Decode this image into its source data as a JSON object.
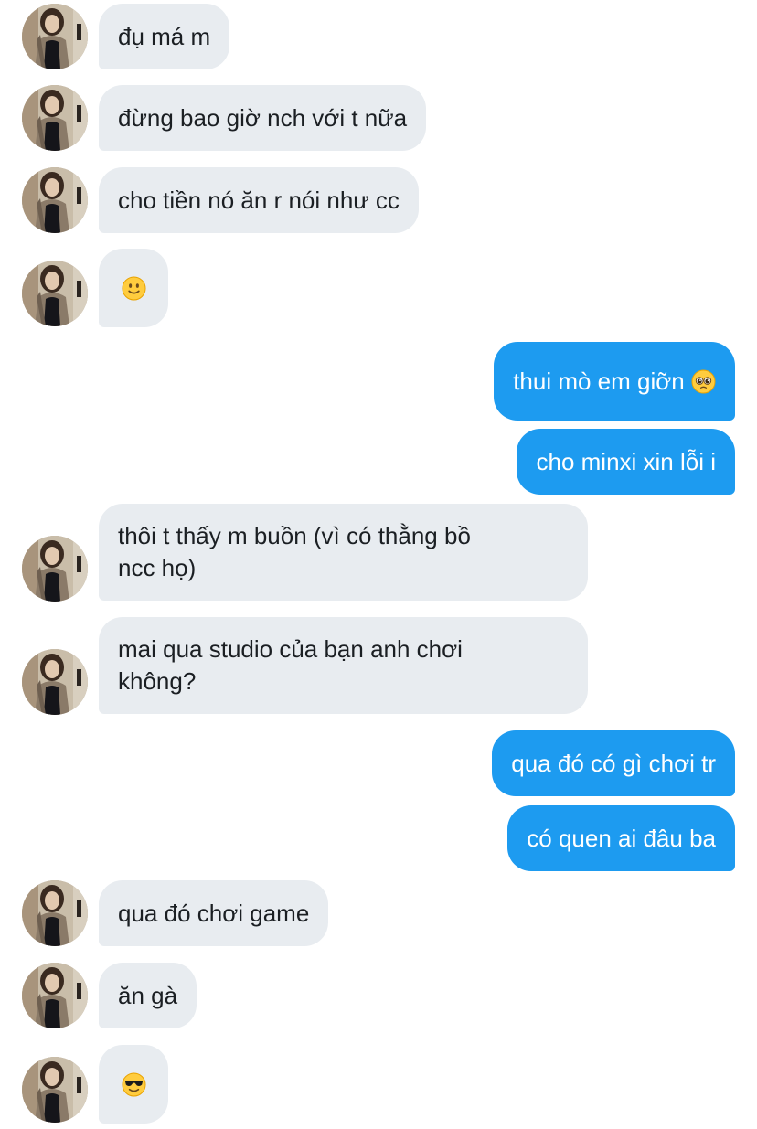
{
  "colors": {
    "incoming_bubble": "#e8ecf0",
    "outgoing_bubble": "#1d9bf0",
    "incoming_text": "#1b1f23",
    "outgoing_text": "#ffffff"
  },
  "messages": [
    {
      "direction": "incoming",
      "text": "đụ má m"
    },
    {
      "direction": "incoming",
      "text": "đừng bao giờ nch với t nữa"
    },
    {
      "direction": "incoming",
      "text": "cho tiền nó ăn r nói như cc"
    },
    {
      "direction": "incoming",
      "emoji": "slightly-smiling-face-icon"
    },
    {
      "direction": "outgoing",
      "text": "thui mò em giỡn",
      "emoji": "pleading-face-icon"
    },
    {
      "direction": "outgoing",
      "text": "cho minxi xin lỗi i"
    },
    {
      "direction": "incoming",
      "lines": [
        "thôi t thấy m buồn (vì có thằng bồ",
        "ncc họ)"
      ]
    },
    {
      "direction": "incoming",
      "lines": [
        "mai qua studio của bạn anh chơi",
        "không?"
      ]
    },
    {
      "direction": "outgoing",
      "text": "qua đó có gì chơi tr"
    },
    {
      "direction": "outgoing",
      "text": "có quen ai đâu ba"
    },
    {
      "direction": "incoming",
      "text": "qua đó chơi game"
    },
    {
      "direction": "incoming",
      "text": "ăn gà"
    },
    {
      "direction": "incoming",
      "emoji": "smiling-face-with-sunglasses-icon"
    }
  ]
}
